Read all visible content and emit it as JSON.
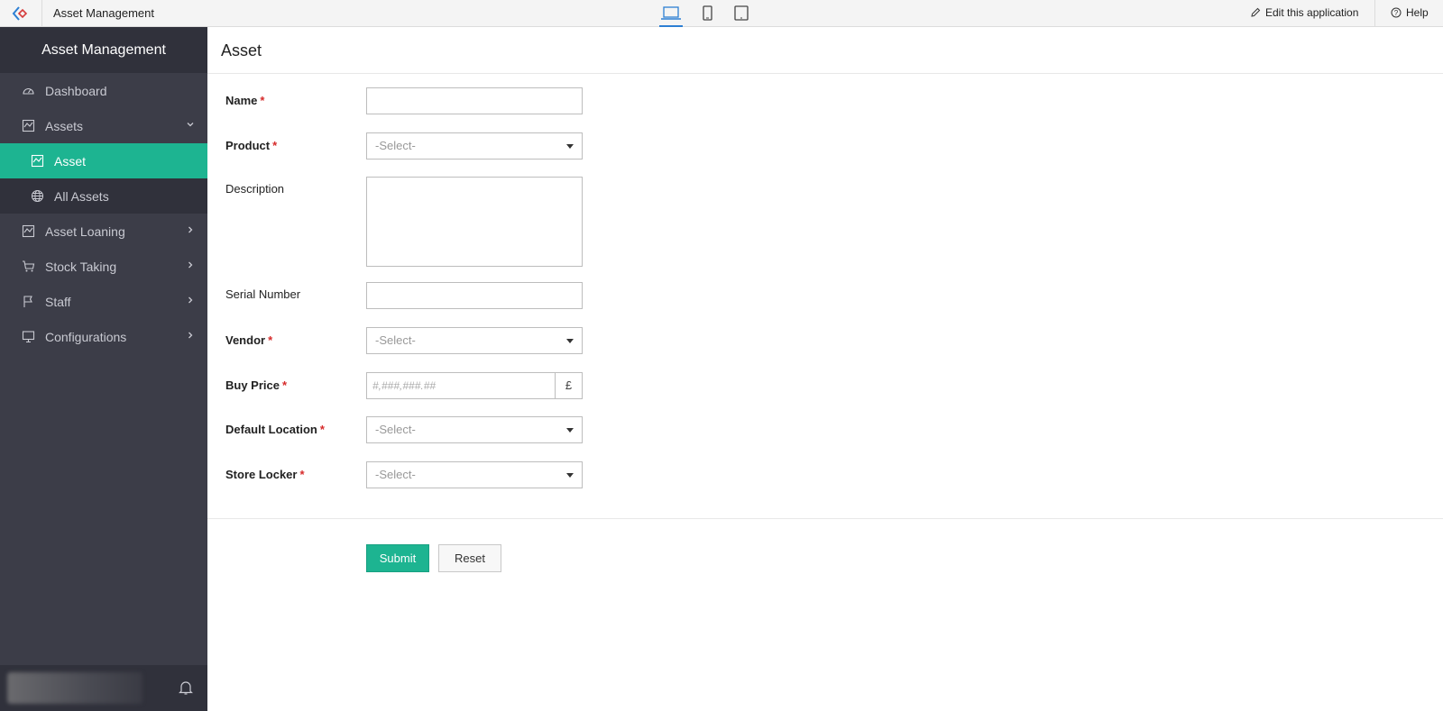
{
  "topbar": {
    "app_title": "Asset Management",
    "edit_label": "Edit this application",
    "help_label": "Help",
    "active_device": "desktop"
  },
  "sidebar": {
    "brand": "Asset Management",
    "items": [
      {
        "label": "Dashboard",
        "icon": "dashboard-icon"
      },
      {
        "label": "Assets",
        "icon": "chart-icon",
        "expanded": true
      },
      {
        "label": "Asset",
        "icon": "chart-icon",
        "active": true
      },
      {
        "label": "All Assets",
        "icon": "globe-icon"
      },
      {
        "label": "Asset Loaning",
        "icon": "chart-icon"
      },
      {
        "label": "Stock Taking",
        "icon": "cart-icon"
      },
      {
        "label": "Staff",
        "icon": "flag-icon"
      },
      {
        "label": "Configurations",
        "icon": "monitor-icon"
      }
    ]
  },
  "form": {
    "title": "Asset",
    "fields": {
      "name": {
        "label": "Name",
        "required": true,
        "value": ""
      },
      "product": {
        "label": "Product",
        "required": true,
        "value": "-Select-"
      },
      "description": {
        "label": "Description",
        "required": false,
        "value": ""
      },
      "serial_number": {
        "label": "Serial Number",
        "required": false,
        "value": ""
      },
      "vendor": {
        "label": "Vendor",
        "required": true,
        "value": "-Select-"
      },
      "buy_price": {
        "label": "Buy Price",
        "required": true,
        "placeholder": "#,###,###.##",
        "currency": "£"
      },
      "default_location": {
        "label": "Default Location",
        "required": true,
        "value": "-Select-"
      },
      "store_locker": {
        "label": "Store Locker",
        "required": true,
        "value": "-Select-"
      }
    },
    "required_mark": "*",
    "submit_label": "Submit",
    "reset_label": "Reset"
  },
  "colors": {
    "accent": "#1db491",
    "sidebar_bg": "#3c3d48",
    "sidebar_dark": "#30313b",
    "required": "#d62a2a"
  }
}
